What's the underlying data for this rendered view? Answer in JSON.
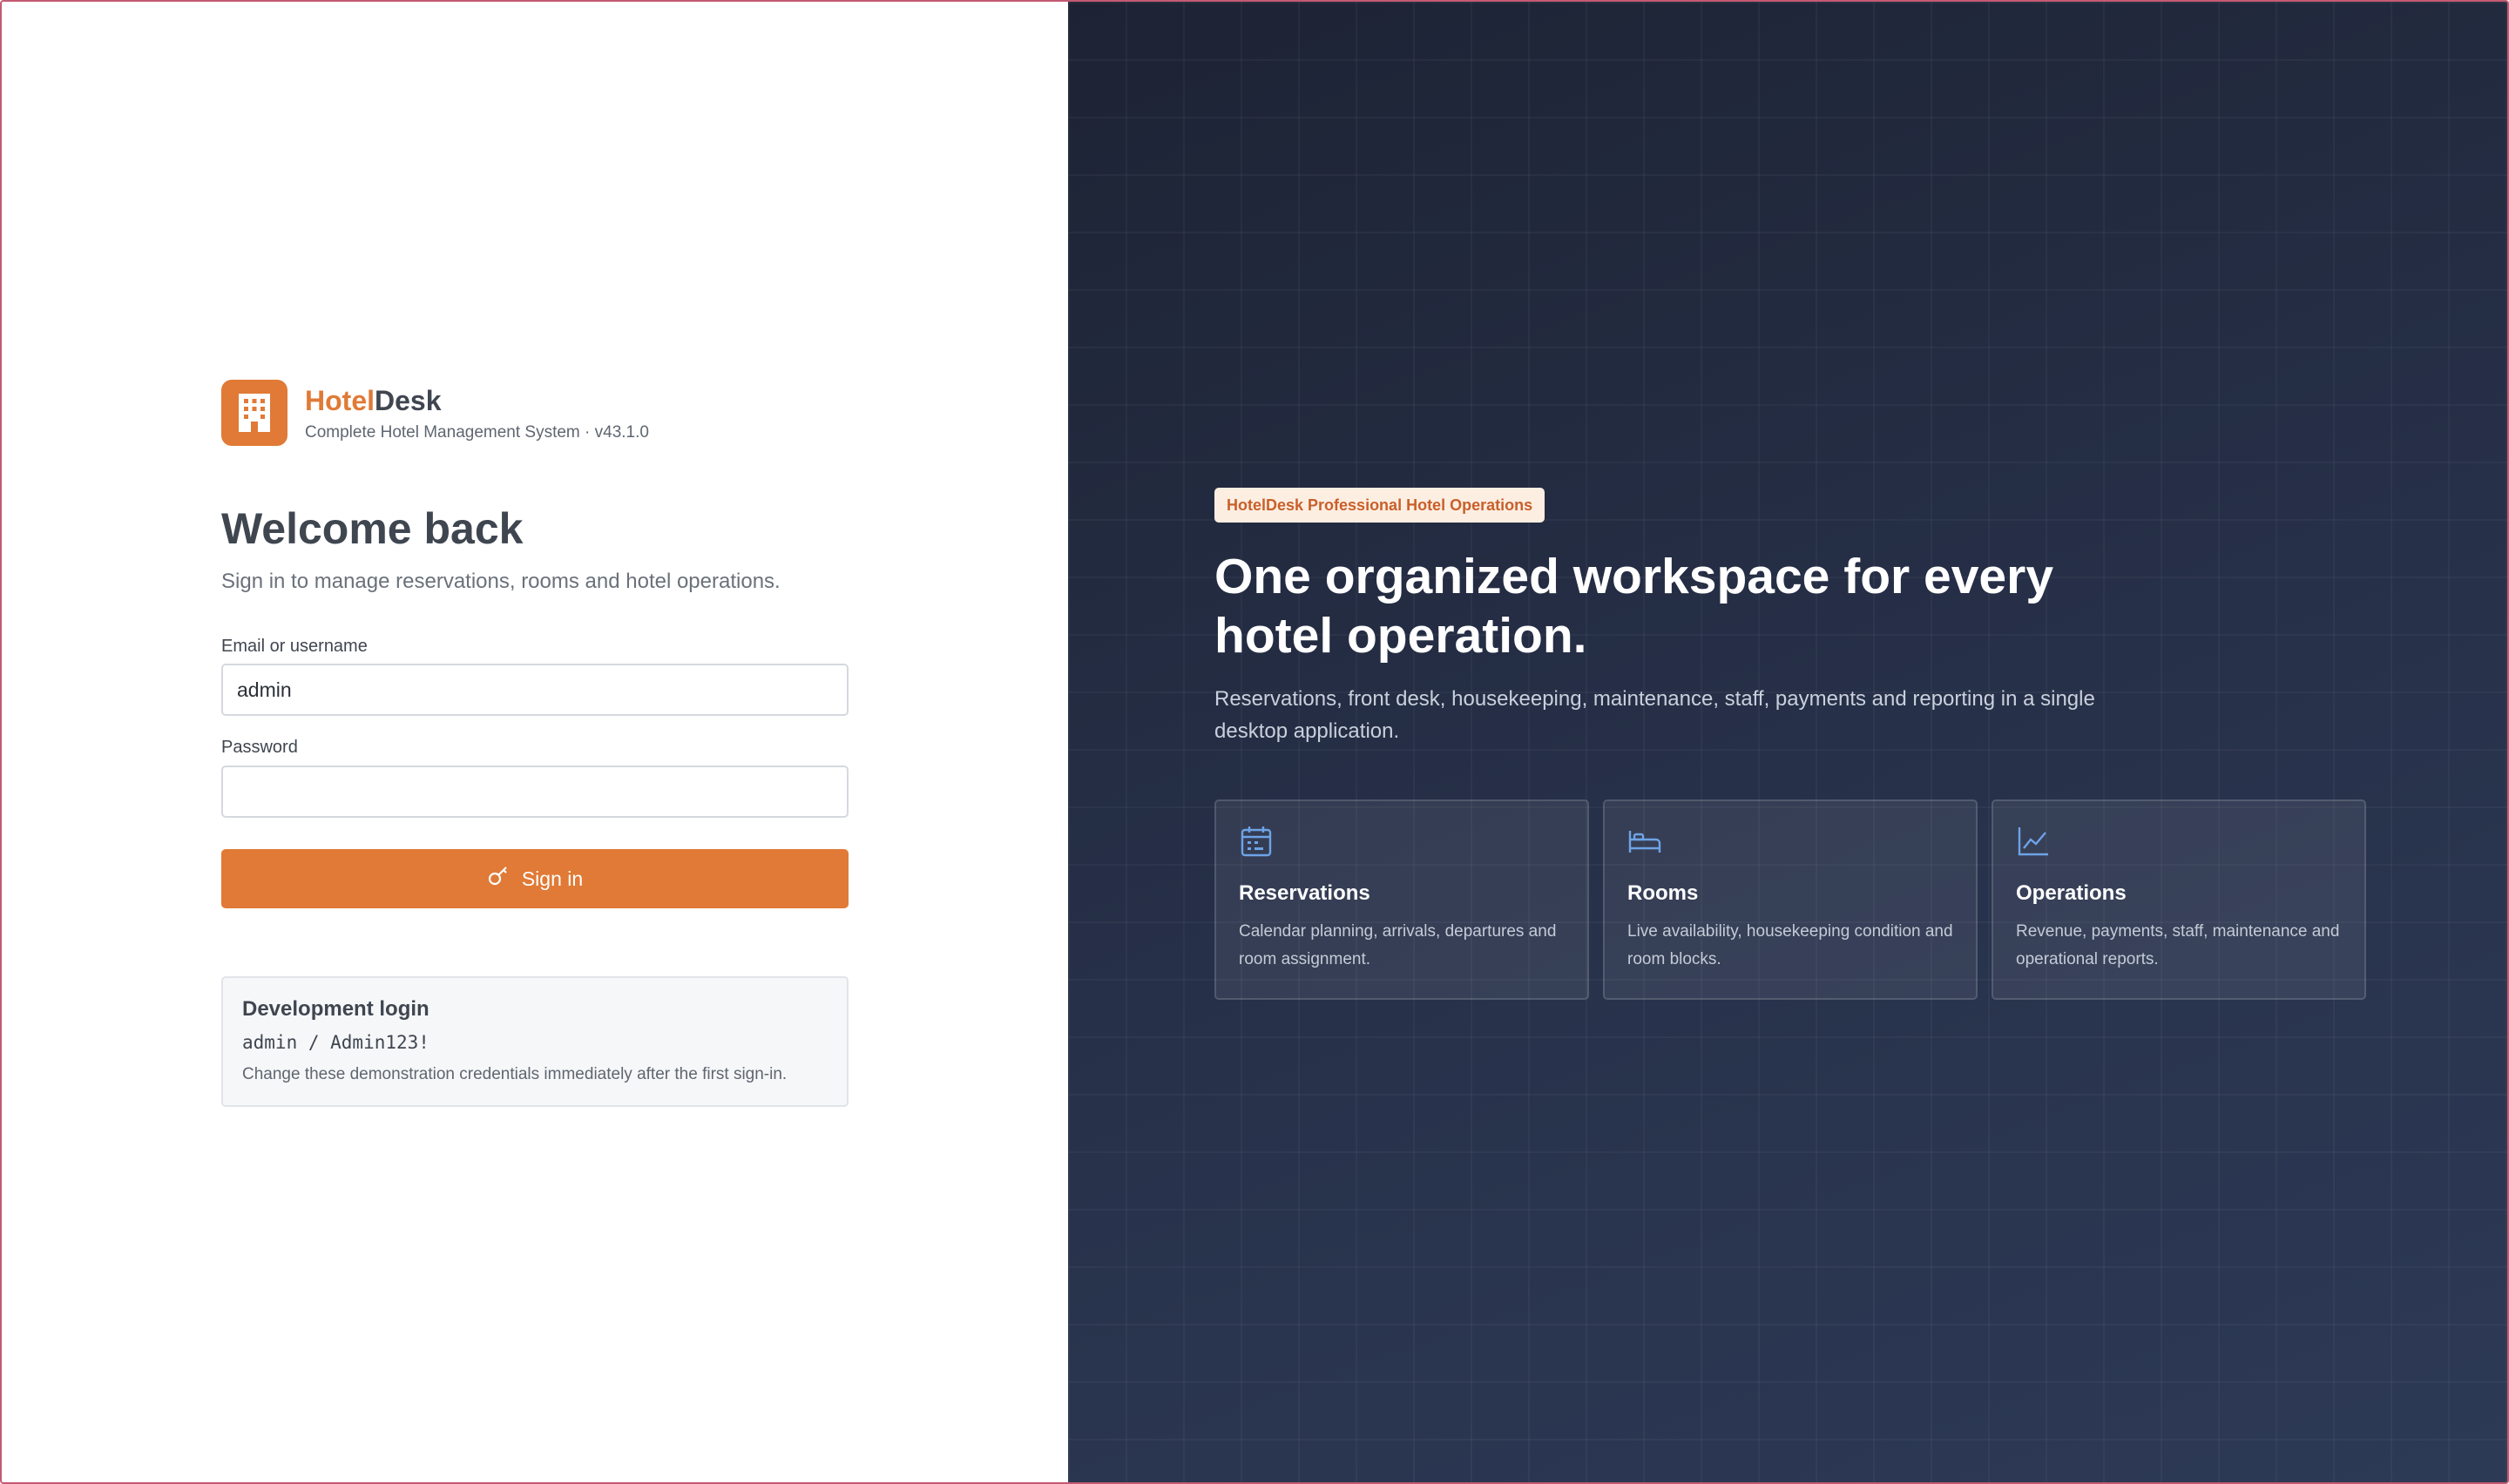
{
  "brand": {
    "name_part1": "Hotel",
    "name_part2": "Desk",
    "subtitle": "Complete Hotel Management System · v43.1.0",
    "icon": "building-icon"
  },
  "login": {
    "title": "Welcome back",
    "subtitle": "Sign in to manage reservations, rooms and hotel operations.",
    "email_label": "Email or username",
    "email_value": "admin",
    "password_label": "Password",
    "password_value": "",
    "signin_label": "Sign in",
    "signin_icon": "key-icon"
  },
  "dev": {
    "title": "Development login",
    "credentials": "admin / Admin123!",
    "note": "Change these demonstration credentials immediately after the first sign-in."
  },
  "hero": {
    "badge": "HotelDesk Professional Hotel Operations",
    "title": "One organized workspace for every hotel operation.",
    "subtitle": "Reservations, front desk, housekeeping, maintenance, staff, payments and reporting in a single desktop application."
  },
  "features": [
    {
      "icon": "calendar-icon",
      "title": "Reservations",
      "desc": "Calendar planning, arrivals, departures and room assignment."
    },
    {
      "icon": "bed-icon",
      "title": "Rooms",
      "desc": "Live availability, housekeeping condition and room blocks."
    },
    {
      "icon": "chart-line-icon",
      "title": "Operations",
      "desc": "Revenue, payments, staff, maintenance and operational reports."
    }
  ],
  "colors": {
    "accent": "#e07a36",
    "panel_dark": "#232c40",
    "icon_blue": "#6ea3e6"
  }
}
